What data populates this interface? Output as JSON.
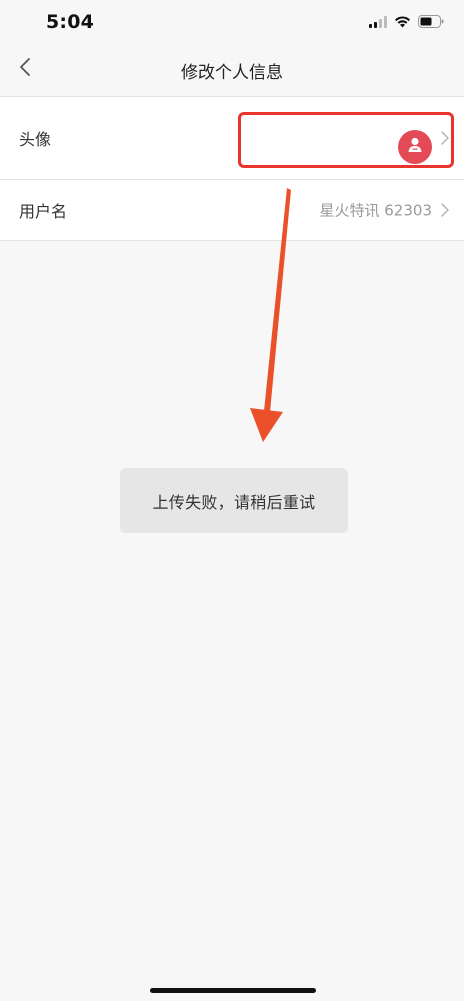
{
  "status_bar": {
    "time": "5:04",
    "icons": [
      "cellular-signal-icon",
      "wifi-icon",
      "battery-icon"
    ]
  },
  "nav": {
    "title": "修改个人信息",
    "back_icon": "chevron-left-icon"
  },
  "rows": [
    {
      "label": "头像",
      "value_type": "avatar",
      "avatar_color": "#e44a55",
      "chevron_icon": "chevron-right-icon"
    },
    {
      "label": "用户名",
      "value": "星火特讯 62303",
      "chevron_icon": "chevron-right-icon"
    }
  ],
  "annotation": {
    "highlight_color": "#e8342c",
    "arrow_color": "#ea5029"
  },
  "toast": {
    "message": "上传失败，请稍后重试"
  }
}
